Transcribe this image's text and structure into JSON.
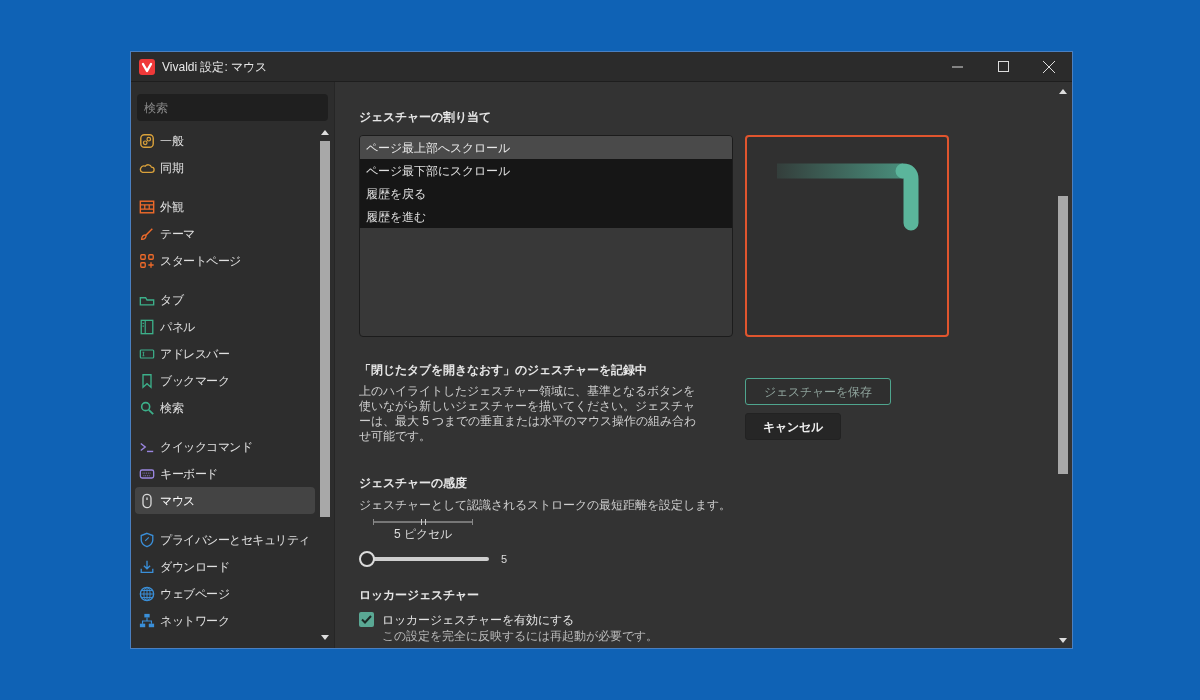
{
  "window": {
    "title": "Vivaldi 設定: マウス"
  },
  "sidebar": {
    "search": {
      "placeholder": "検索"
    },
    "groups": [
      [
        {
          "label": "一般",
          "selected": false
        },
        {
          "label": "同期",
          "selected": false
        }
      ],
      [
        {
          "label": "外観",
          "selected": false
        },
        {
          "label": "テーマ",
          "selected": false
        },
        {
          "label": "スタートページ",
          "selected": false
        }
      ],
      [
        {
          "label": "タブ",
          "selected": false
        },
        {
          "label": "パネル",
          "selected": false
        },
        {
          "label": "アドレスバー",
          "selected": false
        },
        {
          "label": "ブックマーク",
          "selected": false
        },
        {
          "label": "検索",
          "selected": false
        }
      ],
      [
        {
          "label": "クイックコマンド",
          "selected": false
        },
        {
          "label": "キーボード",
          "selected": false
        },
        {
          "label": "マウス",
          "selected": true
        }
      ],
      [
        {
          "label": "プライバシーとセキュリティ",
          "selected": false
        },
        {
          "label": "ダウンロード",
          "selected": false
        },
        {
          "label": "ウェブページ",
          "selected": false
        },
        {
          "label": "ネットワーク",
          "selected": false
        }
      ]
    ]
  },
  "gesture_assignment": {
    "title": "ジェスチャーの割り当て",
    "actions": [
      {
        "label": "ページ最上部へスクロール",
        "selected": true
      },
      {
        "label": "ページ最下部にスクロール",
        "selected": false
      },
      {
        "label": "履歴を戻る",
        "selected": false
      },
      {
        "label": "履歴を進む",
        "selected": false
      }
    ]
  },
  "recording": {
    "title": "「閉じたタブを開きなおす」のジェスチャーを記録中",
    "description": "上のハイライトしたジェスチャー領域に、基準となるボタンを使いながら新しいジェスチャーを描いてください。ジェスチャーは、最大 5 つまでの垂直または水平のマウス操作の組み合わせ可能です。",
    "buttons": [
      {
        "label": "ジェスチャーを保存",
        "kind": "save"
      },
      {
        "label": "キャンセル",
        "kind": "cancel"
      }
    ]
  },
  "sensitivity": {
    "title": "ジェスチャーの感度",
    "description": "ジェスチャーとして認識されるストロークの最短距離を設定します。",
    "scale": {
      "level": 0.5,
      "label": "5 ピクセル"
    },
    "slider": {
      "level": 0,
      "reading": "5"
    }
  },
  "rocker": {
    "title": "ロッカージェスチャー",
    "checkbox": {
      "label": "ロッカージェスチャーを有効にする",
      "checked": true,
      "hint": "この設定を完全に反映するには再起動が必要です。"
    }
  }
}
